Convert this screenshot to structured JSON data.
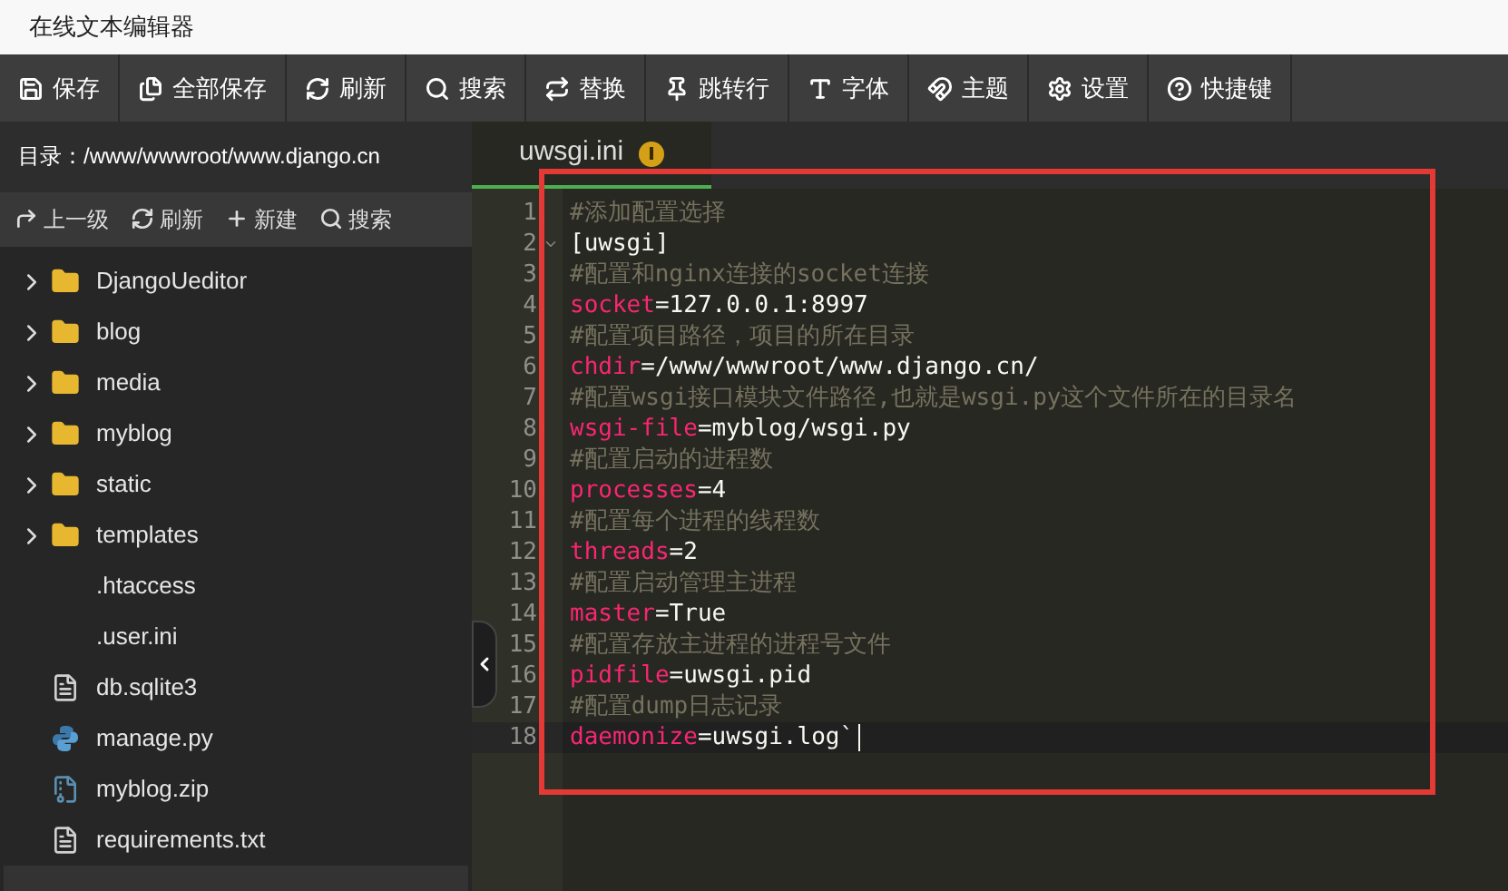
{
  "window": {
    "title": "在线文本编辑器"
  },
  "toolbar": [
    {
      "label": "保存"
    },
    {
      "label": "全部保存"
    },
    {
      "label": "刷新"
    },
    {
      "label": "搜索"
    },
    {
      "label": "替换"
    },
    {
      "label": "跳转行"
    },
    {
      "label": "字体"
    },
    {
      "label": "主题"
    },
    {
      "label": "设置"
    },
    {
      "label": "快捷键"
    }
  ],
  "sidebar": {
    "path": "目录：/www/wwwroot/www.django.cn",
    "actions": [
      {
        "label": "上一级"
      },
      {
        "label": "刷新"
      },
      {
        "label": "新建"
      },
      {
        "label": "搜索"
      }
    ],
    "items": [
      {
        "kind": "folder",
        "name": "DjangoUeditor"
      },
      {
        "kind": "folder",
        "name": "blog"
      },
      {
        "kind": "folder",
        "name": "media"
      },
      {
        "kind": "folder",
        "name": "myblog"
      },
      {
        "kind": "folder",
        "name": "static"
      },
      {
        "kind": "folder",
        "name": "templates"
      },
      {
        "kind": "plain",
        "name": ".htaccess"
      },
      {
        "kind": "plain",
        "name": ".user.ini"
      },
      {
        "kind": "file",
        "name": "db.sqlite3"
      },
      {
        "kind": "python",
        "name": "manage.py"
      },
      {
        "kind": "archive",
        "name": "myblog.zip"
      },
      {
        "kind": "file",
        "name": "requirements.txt"
      }
    ]
  },
  "tabs": [
    {
      "label": "uwsgi.ini",
      "selected": true,
      "modified": true
    }
  ],
  "editor": {
    "lines": [
      {
        "number": "1",
        "kind": "comment",
        "text": "#添加配置选择"
      },
      {
        "number": "2",
        "kind": "section",
        "text": "[uwsgi]",
        "foldable": true
      },
      {
        "number": "3",
        "kind": "comment",
        "text": "#配置和nginx连接的socket连接"
      },
      {
        "number": "4",
        "kind": "setting",
        "key": "socket",
        "value": "=127.0.0.1:8997"
      },
      {
        "number": "5",
        "kind": "comment",
        "text": "#配置项目路径，项目的所在目录"
      },
      {
        "number": "6",
        "kind": "setting",
        "key": "chdir",
        "value": "=/www/wwwroot/www.django.cn/"
      },
      {
        "number": "7",
        "kind": "comment",
        "text": "#配置wsgi接口模块文件路径,也就是wsgi.py这个文件所在的目录名"
      },
      {
        "number": "8",
        "kind": "setting",
        "key": "wsgi-file",
        "value": "=myblog/wsgi.py"
      },
      {
        "number": "9",
        "kind": "comment",
        "text": "#配置启动的进程数"
      },
      {
        "number": "10",
        "kind": "setting",
        "key": "processes",
        "value": "=4"
      },
      {
        "number": "11",
        "kind": "comment",
        "text": "#配置每个进程的线程数"
      },
      {
        "number": "12",
        "kind": "setting",
        "key": "threads",
        "value": "=2"
      },
      {
        "number": "13",
        "kind": "comment",
        "text": "#配置启动管理主进程"
      },
      {
        "number": "14",
        "kind": "setting",
        "key": "master",
        "value": "=True"
      },
      {
        "number": "15",
        "kind": "comment",
        "text": "#配置存放主进程的进程号文件"
      },
      {
        "number": "16",
        "kind": "setting",
        "key": "pidfile",
        "value": "=uwsgi.pid"
      },
      {
        "number": "17",
        "kind": "comment",
        "text": "#配置dump日志记录"
      },
      {
        "number": "18",
        "kind": "setting",
        "key": "daemonize",
        "value": "=uwsgi.log`",
        "active": true
      }
    ]
  }
}
